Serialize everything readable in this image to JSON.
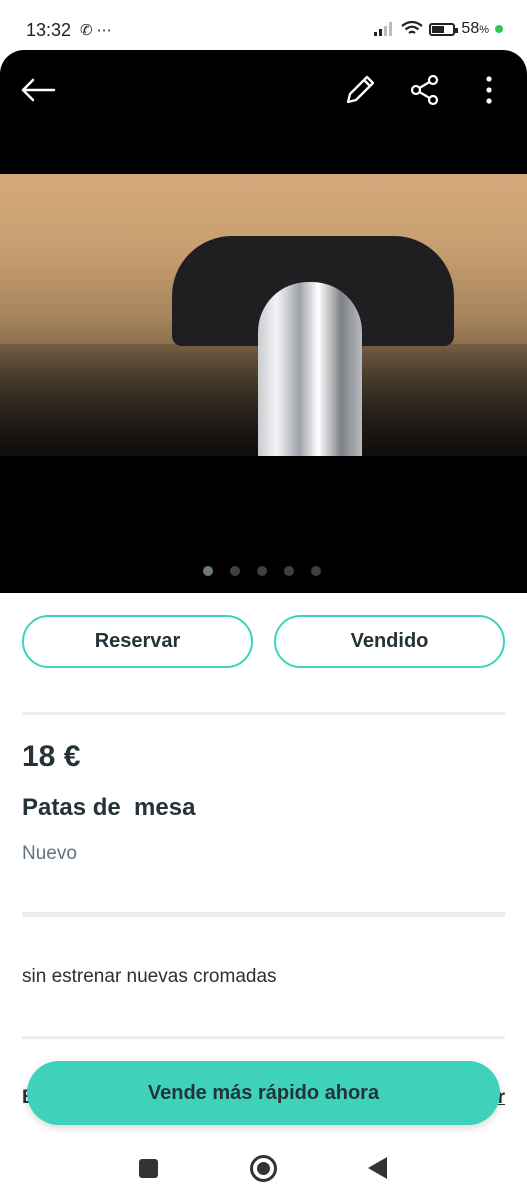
{
  "status_bar": {
    "time": "13:32",
    "left_icons": "✆ ⋯",
    "battery": "58",
    "battery_suffix": "%"
  },
  "top_bar": {
    "back_icon": "arrow-left-icon",
    "edit_icon": "pencil-icon",
    "share_icon": "share-icon",
    "more_icon": "more-vertical-icon"
  },
  "gallery": {
    "image_count": 5,
    "active_index": 0
  },
  "actions": {
    "reserve_label": "Reservar",
    "sold_label": "Vendido"
  },
  "item": {
    "price": "18 €",
    "title": "Patas de  mesa",
    "condition": "Nuevo",
    "description": "sin estrenar nuevas cromadas"
  },
  "partial_row": {
    "left_fragment": "E",
    "right_fragment": "r"
  },
  "cta": {
    "label": "Vende más rápido ahora"
  },
  "colors": {
    "accent": "#3fd2bb",
    "text": "#253238",
    "muted": "#5e7484"
  }
}
